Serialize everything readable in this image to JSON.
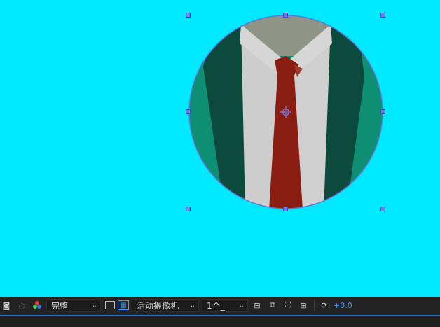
{
  "composition": {
    "background": "#00e9ff",
    "layer_name": "shirt-and-tie circle"
  },
  "toolbar": {
    "resolution": "完整",
    "camera": "活动摄像机",
    "views": "1个_",
    "exposure": "+0.0",
    "icons": [
      "camera-icon",
      "snapshot-icon",
      "color-channels-icon",
      "fullscreen-icon",
      "transparency-grid-icon",
      "layout-icon",
      "snapshot-show-icon",
      "3d-draft-icon",
      "flowchart-icon",
      "exposure-reset-icon"
    ]
  },
  "colors": {
    "toolbar_bg": "#232323",
    "accent_blue": "#4a9bff",
    "jacket_dark": "#0c4a3d",
    "jacket_light": "#0e8f74",
    "shirt": "#cdcdcd",
    "tie": "#8a1d12"
  }
}
